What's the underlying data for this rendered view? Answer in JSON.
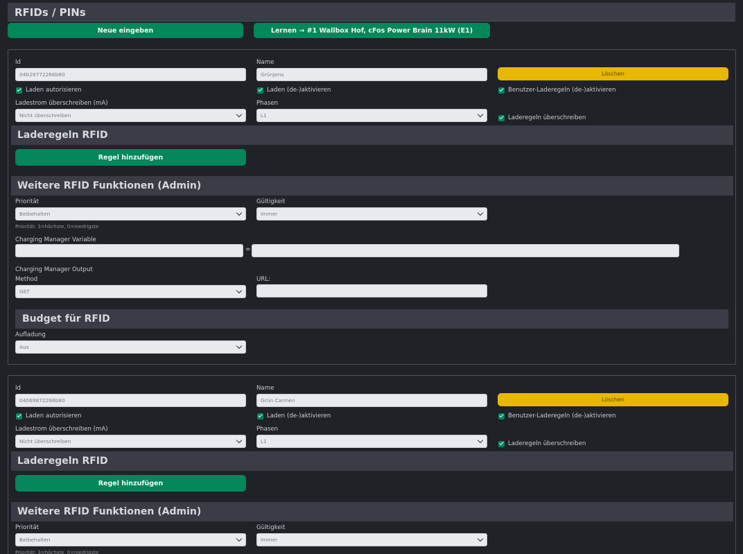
{
  "page": {
    "title": "RFIDs / PINs",
    "new_button": "Neue eingeben",
    "learn_button": "Lernen → #1 Wallbox Hof, cFos Power Brain 11kW (E1)"
  },
  "labels": {
    "id": "Id",
    "name": "Name",
    "delete": "Löschen",
    "auth": "Laden autorisieren",
    "toggle": "Laden (de-)aktivieren",
    "user_rules": "Benutzer-Laderegeln (de-)aktivieren",
    "current": "Ladestrom überschreiben (mA)",
    "phases": "Phasen",
    "override_rules": "Laderegeln überschreiben",
    "rules_title": "Laderegeln RFID",
    "add_rule": "Regel hinzufügen",
    "admin_title": "Weitere RFID Funktionen (Admin)",
    "priority": "Priorität",
    "validity": "Gültigkeit",
    "priority_hint": "Priorität: 3=höchste, 0=niedrigste",
    "cm_variable": "Charging Manager Variable",
    "equals": "=",
    "cm_output": "Charging Manager Output",
    "method": "Method",
    "url": "URL:",
    "budget_title": "Budget für RFID",
    "charging": "Aufladung"
  },
  "cards": [
    {
      "id_value": "04b29772266b80",
      "name_value": "GrünJens",
      "current_value": "Nicht überschreiben",
      "phases_value": "L1",
      "priority_value": "Beibehalten",
      "validity_value": "Immer",
      "method_value": "GET",
      "url_value": "",
      "cm_var_value": "",
      "cm_eq_value": "",
      "charging_value": "Aus"
    },
    {
      "id_value": "04069872266b80",
      "name_value": "Grün Carmen",
      "current_value": "Nicht überschreiben",
      "phases_value": "L1",
      "priority_value": "Beibehalten",
      "validity_value": "Immer"
    }
  ],
  "colors": {
    "accent_green": "#03875b",
    "delete_yellow": "#e8b703",
    "background": "#1f2227",
    "section_bar": "#3a3d45"
  }
}
